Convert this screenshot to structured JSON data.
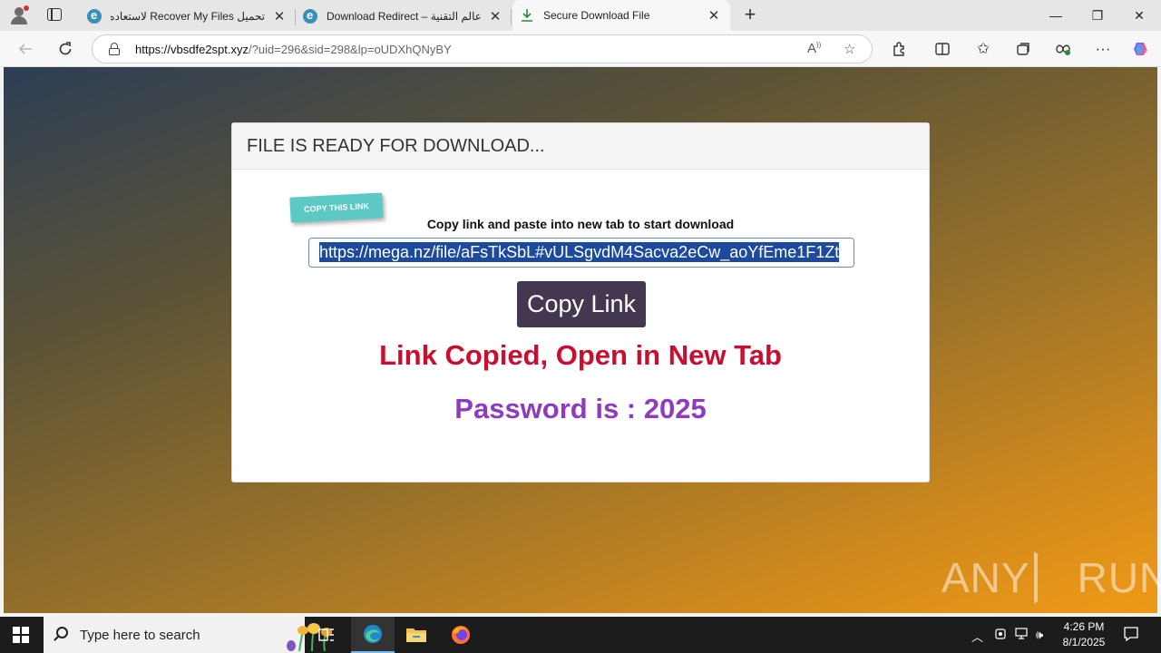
{
  "browser": {
    "tabs": [
      {
        "title": "تحميل Recover My Files لاستعاده ا",
        "close": "✕"
      },
      {
        "title": "Download Redirect – عالم التقنية",
        "close": "✕"
      },
      {
        "title": "Secure Download File",
        "close": "✕"
      }
    ],
    "new_tab": "+",
    "window_controls": {
      "minimize": "—",
      "restore": "❐",
      "close": "✕"
    },
    "address": {
      "host": "https://vbsdfe2spt.xyz",
      "path": "/?uid=296&sid=298&lp=oUDXhQNyBY"
    }
  },
  "page": {
    "header": "FILE IS READY FOR DOWNLOAD...",
    "sticker": "COPY THIS LINK",
    "instruction": "Copy link and paste into new tab to start download",
    "link_value": "https://mega.nz/file/aFsTkSbL#vULSgvdM4Sacva2eCw_aoYfEme1F1Zt",
    "copy_button": "Copy Link",
    "copied_message": "Link Copied, Open in New Tab",
    "password_message": "Password is : 2025",
    "watermark": {
      "left": "ANY",
      "right": "RUN"
    }
  },
  "taskbar": {
    "search_placeholder": "Type here to search",
    "time": "4:26 PM",
    "date": "8/1/2025"
  },
  "colors": {
    "copy_button": "#43384f",
    "copied_message": "#c8102e",
    "password_message": "#8e3bbf",
    "sticker": "#5cc9c4"
  }
}
